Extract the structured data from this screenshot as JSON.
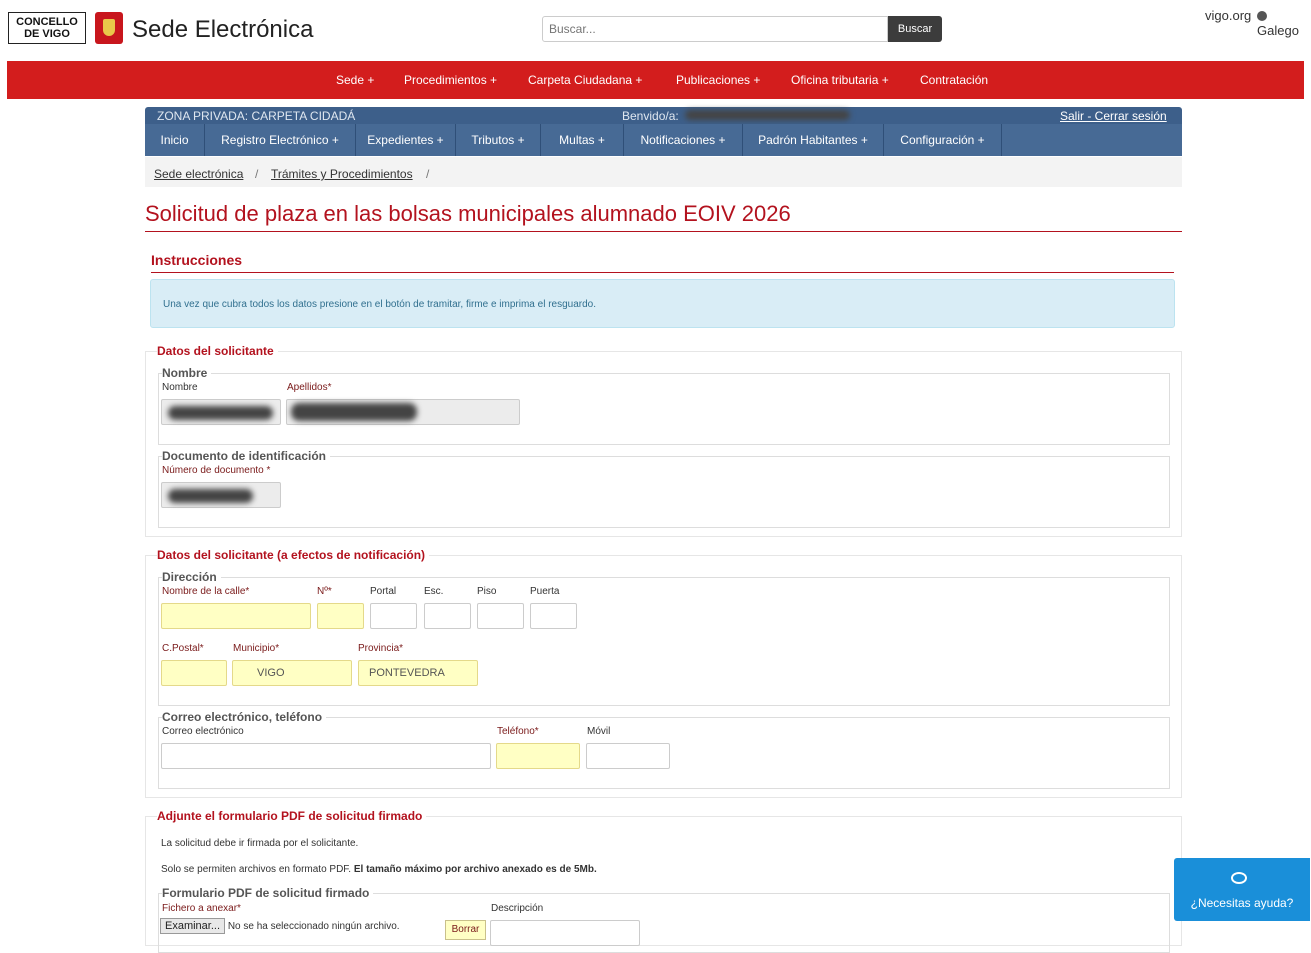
{
  "header": {
    "logo_line1": "CONCELLO",
    "logo_line2": "DE VIGO",
    "site_title": "Sede Electrónica",
    "search_placeholder": "Buscar...",
    "search_button": "Buscar",
    "vigo_link": "vigo.org",
    "lang_link": "Galego"
  },
  "main_nav": [
    "Sede +",
    "Procedimientos +",
    "Carpeta Ciudadana +",
    "Publicaciones +",
    "Oficina tributaria +",
    "Contratación"
  ],
  "zone": {
    "label": "ZONA PRIVADA: CARPETA CIDADÁ",
    "welcome": "Benvido/a:",
    "logout": "Salir - Cerrar sesión"
  },
  "private_nav": [
    "Inicio",
    "Registro Electrónico +",
    "Expedientes +",
    "Tributos +",
    "Multas +",
    "Notificaciones +",
    "Padrón Habitantes +",
    "Configuración +"
  ],
  "breadcrumb": [
    "Sede electrónica",
    "Trámites y Procedimientos"
  ],
  "page_title": "Solicitud de plaza en las bolsas municipales alumnado EOIV 2026",
  "instructions": {
    "title": "Instrucciones",
    "text": "Una vez que cubra todos los datos presione en el botón de tramitar, firme e imprima el resguardo."
  },
  "applicant": {
    "title": "Datos del solicitante",
    "name_legend": "Nombre",
    "name_label": "Nombre",
    "surname_label": "Apellidos*",
    "doc_legend": "Documento de identificación",
    "doc_label": "Número de documento *"
  },
  "notification": {
    "title": "Datos del solicitante (a efectos de notificación)",
    "address_legend": "Dirección",
    "street_label": "Nombre de la calle*",
    "number_label": "Nº*",
    "portal_label": "Portal",
    "stair_label": "Esc.",
    "floor_label": "Piso",
    "door_label": "Puerta",
    "postal_label": "C.Postal*",
    "municipality_label": "Municipio*",
    "municipality_value": "VIGO",
    "province_label": "Provincia*",
    "province_value": "PONTEVEDRA",
    "contact_legend": "Correo electrónico, teléfono",
    "email_label": "Correo electrónico",
    "phone_label": "Teléfono*",
    "mobile_label": "Móvil"
  },
  "attachment": {
    "title": "Adjunte el formulario PDF de solicitud firmado",
    "note1": "La solicitud debe ir firmada por el solicitante.",
    "note2_a": "Solo se permiten archivos en formato PDF.",
    "note2_b": "El tamaño máximo por archivo anexado es de 5Mb.",
    "legend": "Formulario PDF de solicitud firmado",
    "file_label": "Fichero a anexar*",
    "desc_label": "Descripción",
    "browse_button": "Examinar...",
    "no_file": "No se ha seleccionado ningún archivo.",
    "clear_button": "Borrar"
  },
  "help_button": "¿Necesitas ayuda?"
}
